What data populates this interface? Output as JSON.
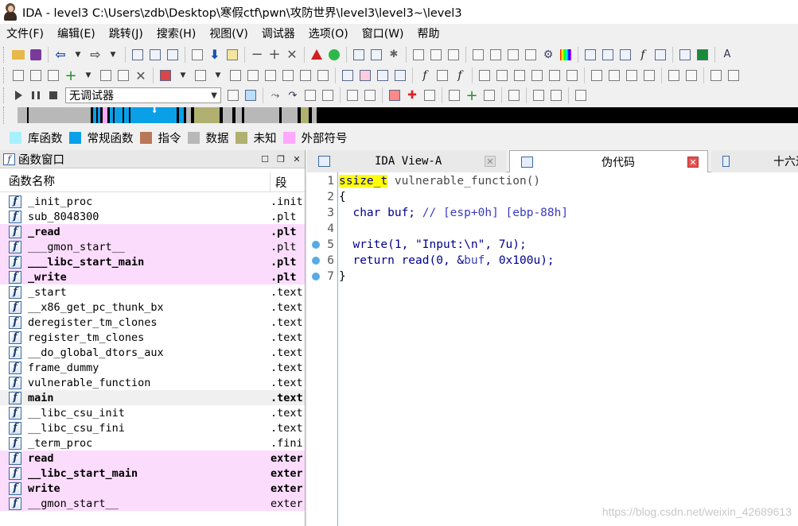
{
  "window": {
    "title": "IDA - level3 C:\\Users\\zdb\\Desktop\\寒假ctf\\pwn\\攻防世界\\level3\\level3~\\level3"
  },
  "menu": [
    "文件(F)",
    "编辑(E)",
    "跳转(J)",
    "搜索(H)",
    "视图(V)",
    "调试器",
    "选项(O)",
    "窗口(W)",
    "帮助"
  ],
  "debugger": {
    "selected": "无调试器"
  },
  "legend": [
    {
      "label": "库函数",
      "color": "#a8f0ff"
    },
    {
      "label": "常规函数",
      "color": "#0aa0e8"
    },
    {
      "label": "指令",
      "color": "#b8785a"
    },
    {
      "label": "数据",
      "color": "#b8b8b8"
    },
    {
      "label": "未知",
      "color": "#b0b070"
    },
    {
      "label": "外部符号",
      "color": "#ffa8ff"
    }
  ],
  "functions_window": {
    "title": "函数窗口",
    "columns": {
      "name": "函数名称",
      "segment": "段"
    },
    "rows": [
      {
        "name": "_init_proc",
        "segment": ".init"
      },
      {
        "name": "sub_8048300",
        "segment": ".plt"
      },
      {
        "name": "_read",
        "segment": ".plt"
      },
      {
        "name": "___gmon_start__",
        "segment": ".plt"
      },
      {
        "name": "___libc_start_main",
        "segment": ".plt"
      },
      {
        "name": "_write",
        "segment": ".plt"
      },
      {
        "name": "_start",
        "segment": ".text"
      },
      {
        "name": "__x86_get_pc_thunk_bx",
        "segment": ".text"
      },
      {
        "name": "deregister_tm_clones",
        "segment": ".text"
      },
      {
        "name": "register_tm_clones",
        "segment": ".text"
      },
      {
        "name": "__do_global_dtors_aux",
        "segment": ".text"
      },
      {
        "name": "frame_dummy",
        "segment": ".text"
      },
      {
        "name": "vulnerable_function",
        "segment": ".text"
      },
      {
        "name": "main",
        "segment": ".text"
      },
      {
        "name": "__libc_csu_init",
        "segment": ".text"
      },
      {
        "name": "__libc_csu_fini",
        "segment": ".text"
      },
      {
        "name": "_term_proc",
        "segment": ".fini"
      },
      {
        "name": "read",
        "segment": "extern"
      },
      {
        "name": "__libc_start_main",
        "segment": "extern"
      },
      {
        "name": "write",
        "segment": "extern"
      },
      {
        "name": "__gmon_start__",
        "segment": "extern"
      }
    ]
  },
  "tabs": {
    "ida_view": "IDA View-A",
    "pseudocode": "伪代码",
    "hex": "十六进"
  },
  "code": {
    "line_numbers": [
      "1",
      "2",
      "3",
      "4",
      "5",
      "6",
      "7"
    ],
    "l1_type": "ssize_t",
    "l1_rest": " vulnerable_function()",
    "l2": "{",
    "l3_decl": "  char buf; ",
    "l3_comment": "// [esp+0h] [ebp-88h]",
    "l5_a": "  write(1, ",
    "l5_str": "\"Input:\\n\"",
    "l5_b": ", 7u);",
    "l6_a": "  return ",
    "l6_fn": "read",
    "l6_b": "(0, &",
    "l6_var": "buf",
    "l6_c": ", 0x100u);",
    "l7": "}"
  },
  "watermark": "https://blog.csdn.net/weixin_42689613"
}
